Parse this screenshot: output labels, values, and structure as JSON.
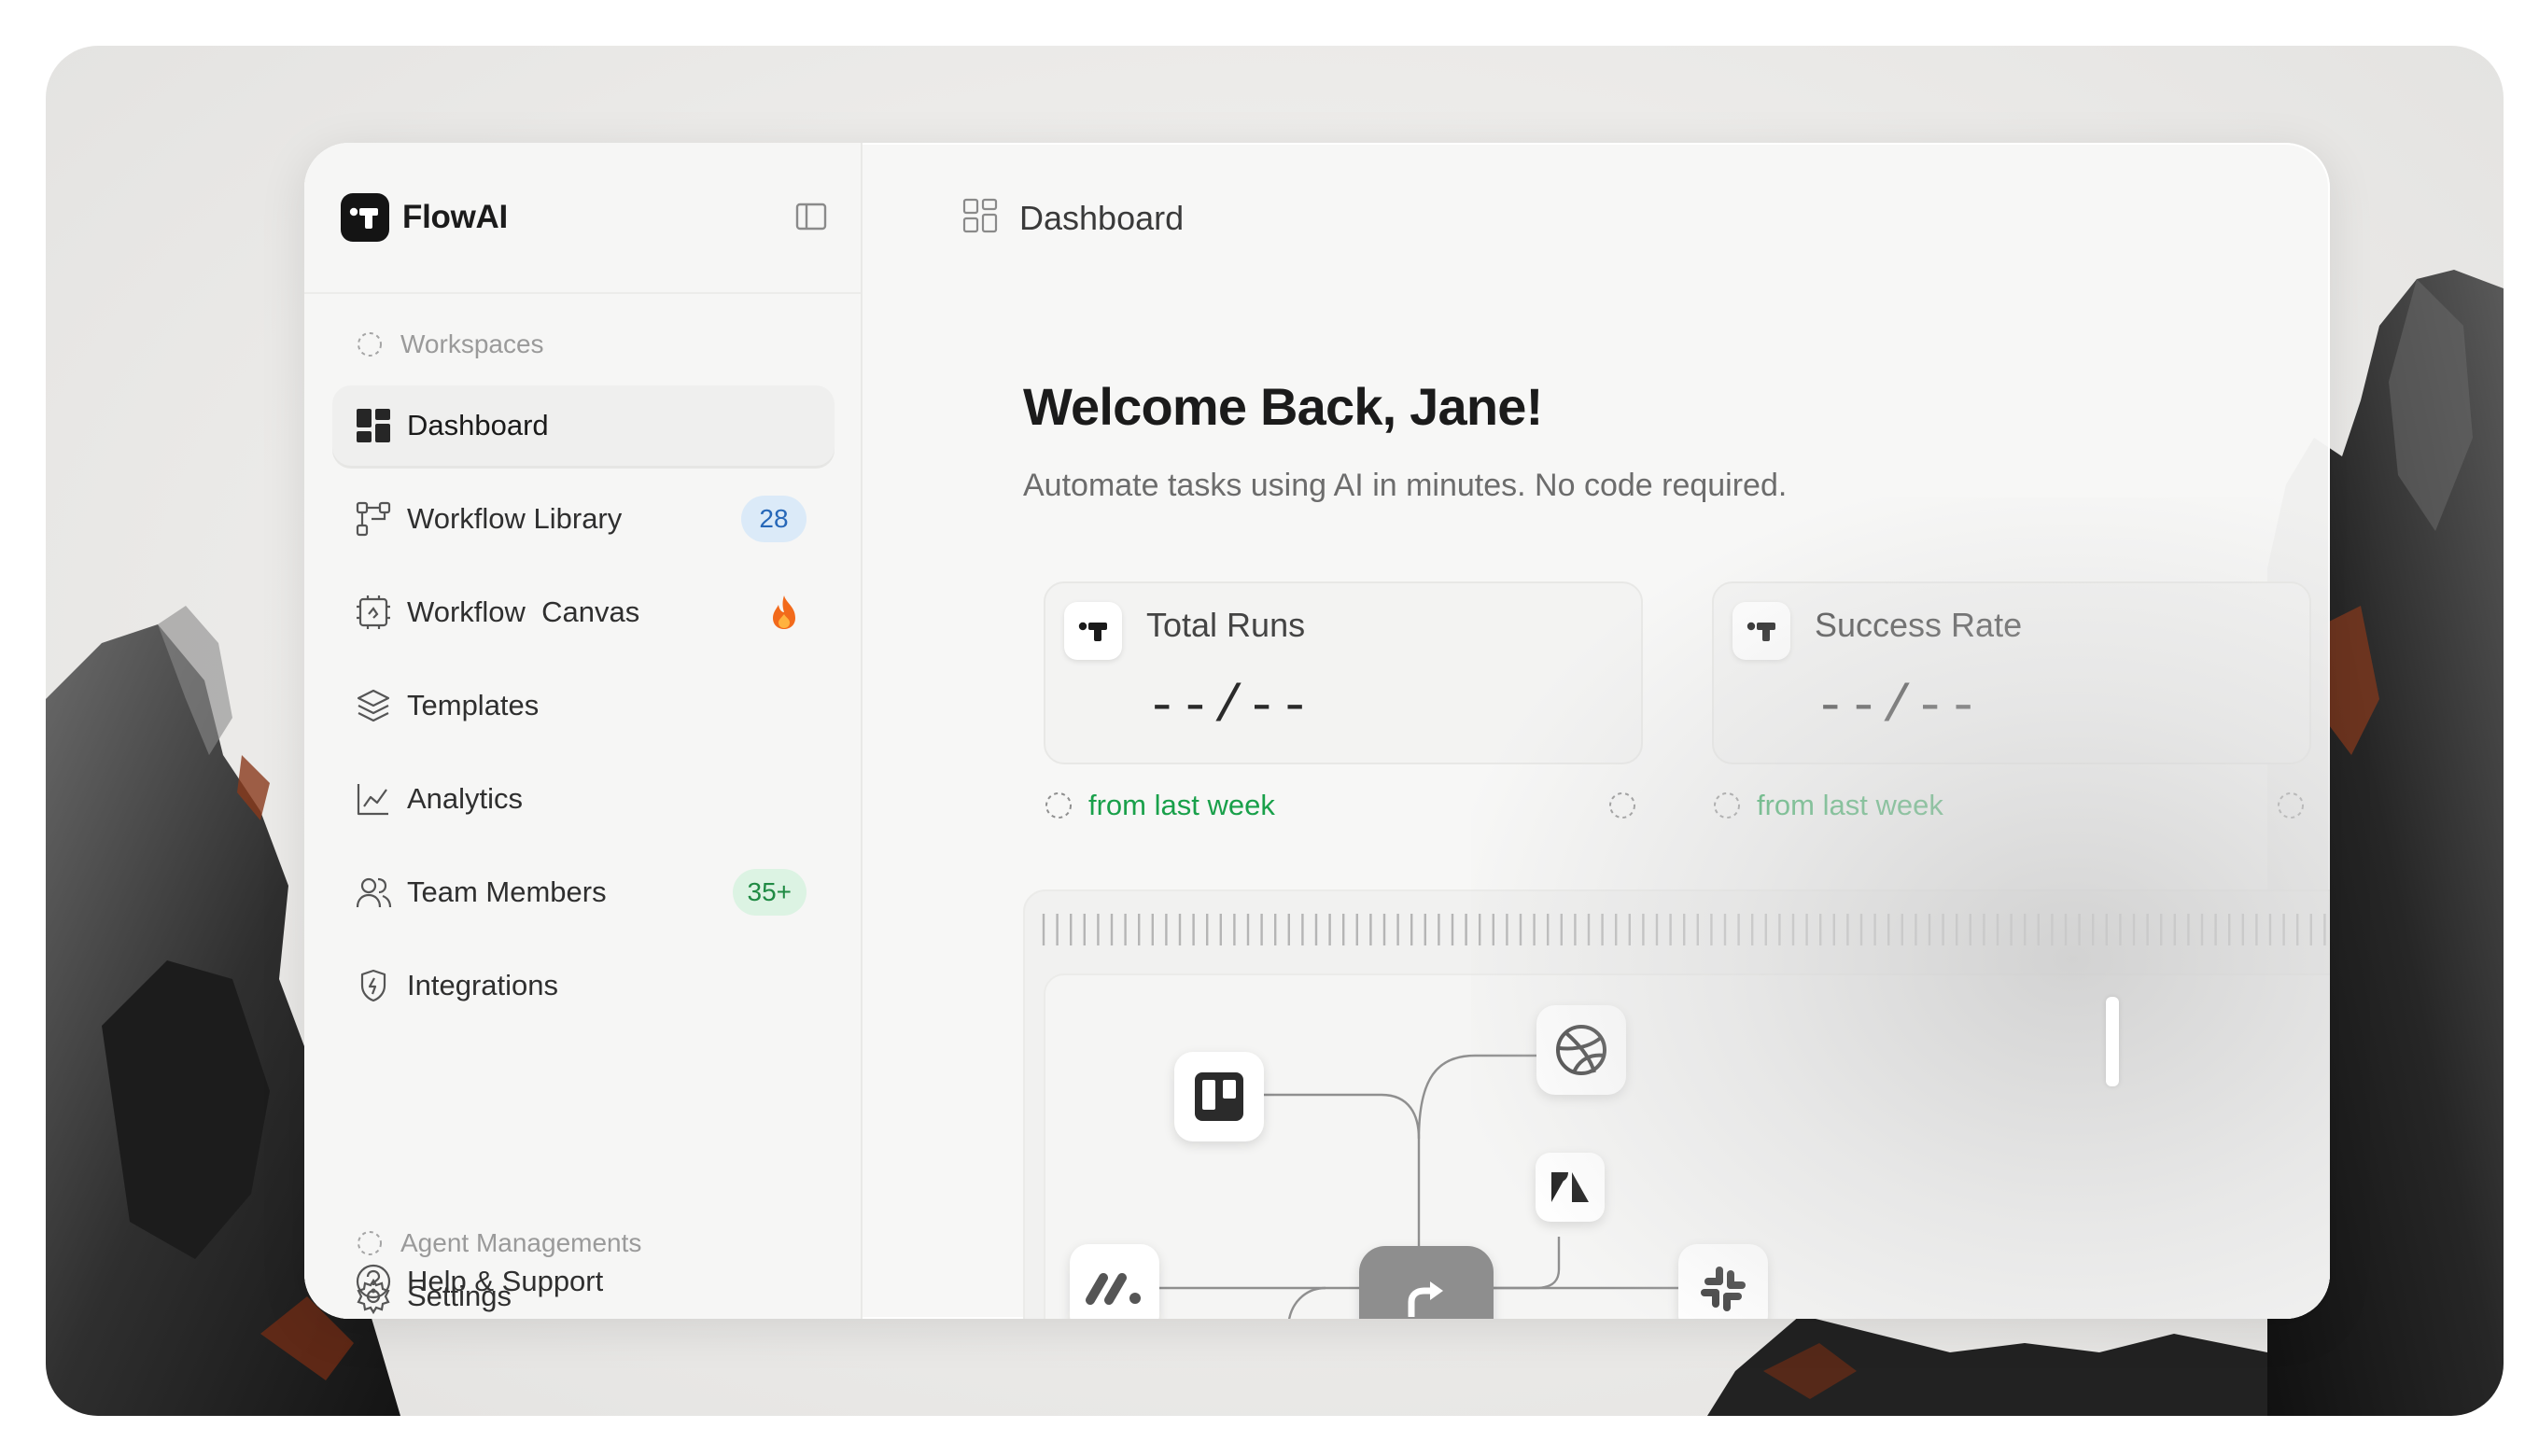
{
  "app": {
    "name": "FlowAI"
  },
  "sidebar": {
    "sections": {
      "workspaces": "Workspaces",
      "agent_managements": "Agent Managements"
    },
    "items": [
      {
        "label": "Dashboard",
        "icon": "dashboard-grid-icon",
        "active": true
      },
      {
        "label": "Workflow Library",
        "icon": "workflow-tree-icon",
        "badge": "28"
      },
      {
        "label": "Workflow  Canvas",
        "icon": "canvas-icon",
        "badge_icon": "fire-icon"
      },
      {
        "label": "Templates",
        "icon": "layers-icon"
      },
      {
        "label": "Analytics",
        "icon": "chart-line-icon"
      },
      {
        "label": "Team Members",
        "icon": "users-icon",
        "badge": "35+"
      },
      {
        "label": "Integrations",
        "icon": "plug-shield-icon"
      },
      {
        "label": "Settings",
        "icon": "gear-icon"
      },
      {
        "label": "Help & Support",
        "icon": "help-circle-icon"
      }
    ]
  },
  "header": {
    "title": "Dashboard",
    "icon": "dashboard-outline-icon"
  },
  "main": {
    "welcome": "Welcome Back, Jane!",
    "subtitle": "Automate tasks using AI in minutes. No code required.",
    "stats": [
      {
        "label": "Total Runs",
        "value": "--/--",
        "trend": "from last week"
      },
      {
        "label": "Success Rate",
        "value": "--/--",
        "trend": "from last week"
      }
    ],
    "canvas_nodes": [
      "trello-icon",
      "dribbble-icon",
      "zendesk-icon",
      "monday-icon",
      "flow-core-icon",
      "slack-icon"
    ]
  },
  "colors": {
    "accent_green": "#19a04a",
    "badge_blue_bg": "#dbeaf8",
    "badge_green_bg": "#dcf3e3",
    "brand_dark": "#141414"
  }
}
